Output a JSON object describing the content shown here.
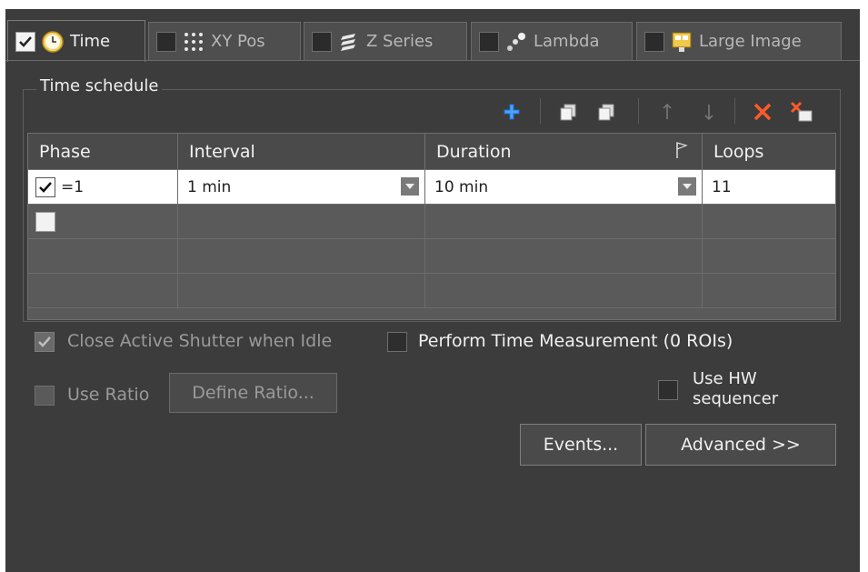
{
  "tabs": [
    {
      "label": "Time",
      "checked": true,
      "icon": "clock-icon",
      "active": true
    },
    {
      "label": "XY Pos",
      "checked": false,
      "icon": "grid-dots-icon",
      "active": false
    },
    {
      "label": "Z Series",
      "checked": false,
      "icon": "z-stack-icon",
      "active": false
    },
    {
      "label": "Lambda",
      "checked": false,
      "icon": "lambda-dots-icon",
      "active": false
    },
    {
      "label": "Large Image",
      "checked": false,
      "icon": "large-image-icon",
      "active": false
    }
  ],
  "schedule": {
    "title": "Time schedule",
    "toolbar": [
      "add-icon",
      "copy-icon",
      "paste-icon",
      "move-up-icon",
      "move-down-icon",
      "delete-icon",
      "delete-all-icon"
    ],
    "columns": [
      "Phase",
      "Interval",
      "Duration",
      "Loops"
    ],
    "rows": [
      {
        "checked": true,
        "phase": "=1",
        "interval": "1 min",
        "duration": "10 min",
        "loops": "11"
      }
    ]
  },
  "options": {
    "close_shutter": "Close Active Shutter when Idle",
    "close_shutter_checked": true,
    "perform_time": "Perform Time Measurement (0 ROIs)",
    "perform_time_checked": false,
    "use_ratio": "Use Ratio",
    "use_ratio_checked": false,
    "define_ratio": "Define Ratio...",
    "use_hw_line1": "Use HW",
    "use_hw_line2": "sequencer",
    "use_hw_checked": false,
    "events": "Events...",
    "advanced": "Advanced >>"
  }
}
